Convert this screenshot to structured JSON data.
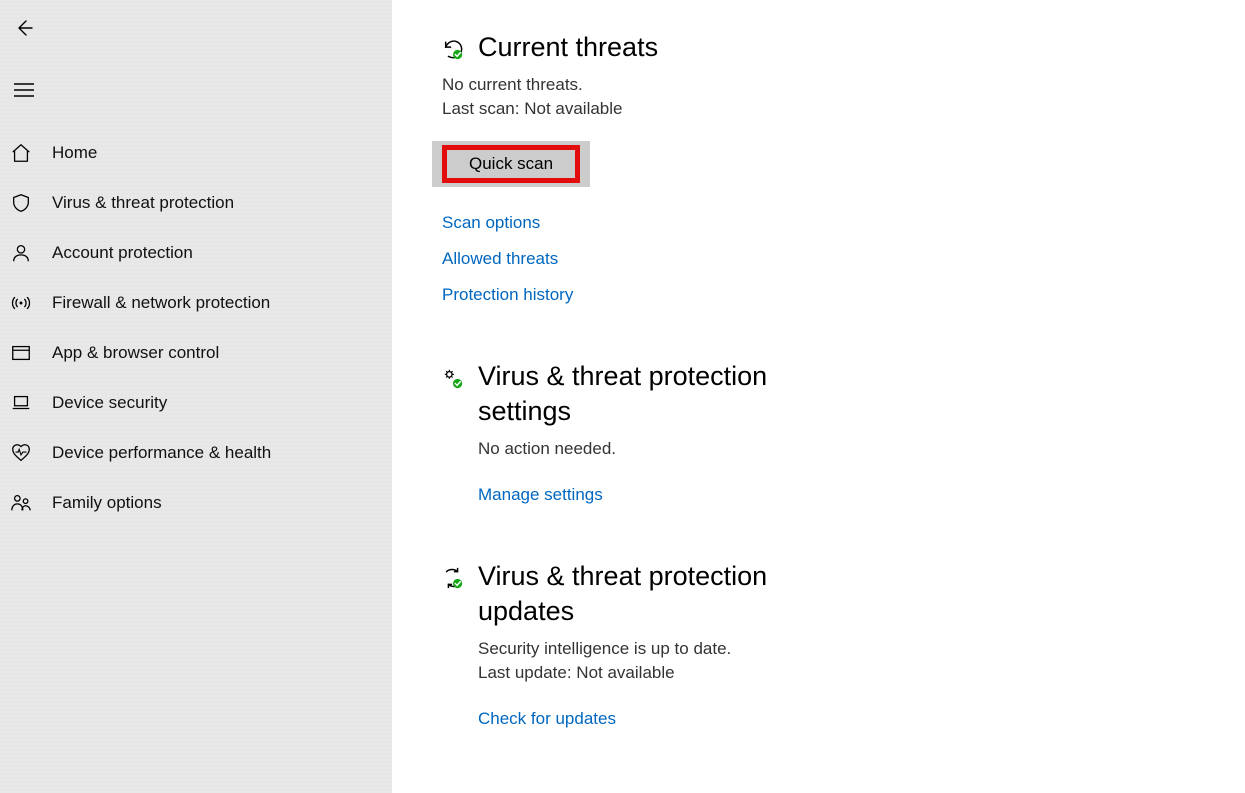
{
  "sidebar": {
    "items": [
      {
        "label": "Home"
      },
      {
        "label": "Virus & threat protection"
      },
      {
        "label": "Account protection"
      },
      {
        "label": "Firewall & network protection"
      },
      {
        "label": "App & browser control"
      },
      {
        "label": "Device security"
      },
      {
        "label": "Device performance & health"
      },
      {
        "label": "Family options"
      }
    ]
  },
  "threats": {
    "title": "Current threats",
    "status": "No current threats.",
    "last_scan": "Last scan: Not available",
    "quick_scan_label": "Quick scan",
    "links": {
      "scan_options": "Scan options",
      "allowed_threats": "Allowed threats",
      "protection_history": "Protection history"
    }
  },
  "settings": {
    "title": "Virus & threat protection settings",
    "status": "No action needed.",
    "manage_link": "Manage settings"
  },
  "updates": {
    "title": "Virus & threat protection updates",
    "status": "Security intelligence is up to date.",
    "last_update": "Last update: Not available",
    "check_link": "Check for updates"
  }
}
